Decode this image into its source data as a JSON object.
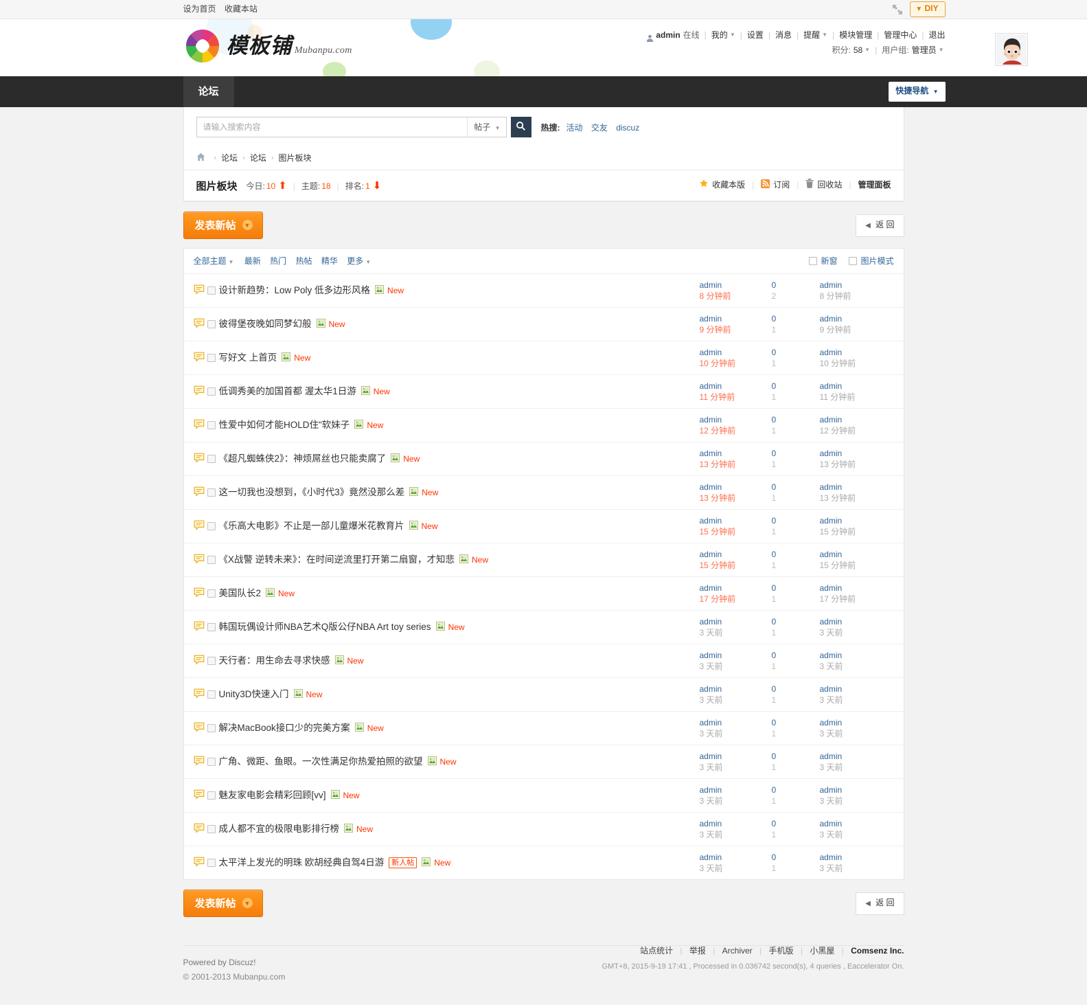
{
  "topbar": {
    "links": [
      "设为首页",
      "收藏本站"
    ],
    "diy_label": "DIY",
    "expand_icon": "expand-icon"
  },
  "logo": {
    "title": "模板铺",
    "subtitle": "Mubanpu.com"
  },
  "user": {
    "name": "admin",
    "status": "在线",
    "menu": [
      "我的",
      "设置",
      "消息",
      "提醒",
      "模块管理",
      "管理中心",
      "退出"
    ],
    "credits_label": "积分:",
    "credits_value": "58",
    "group_label": "用户组:",
    "group_value": "管理员"
  },
  "nav": {
    "items": [
      "论坛"
    ],
    "quicknav": "快捷导航"
  },
  "search": {
    "placeholder": "请输入搜索内容",
    "value": "",
    "type": "帖子",
    "hot_label": "热搜:",
    "hot_links": [
      "活动",
      "交友",
      "discuz"
    ]
  },
  "breadcrumb": {
    "home_icon": "home-icon",
    "items": [
      "论坛",
      "论坛",
      "图片板块"
    ]
  },
  "forum": {
    "title": "图片板块",
    "today_label": "今日:",
    "today_value": "10",
    "threads_label": "主题:",
    "threads_value": "18",
    "rank_label": "排名:",
    "rank_value": "1",
    "actions": [
      "收藏本版",
      "订阅",
      "回收站",
      "管理面板"
    ]
  },
  "actions": {
    "new_thread": "发表新帖",
    "back": "返 回"
  },
  "filter": {
    "all_topics": "全部主题",
    "tabs": [
      "最新",
      "热门",
      "热帖",
      "精华",
      "更多"
    ],
    "newwindow": "新窗",
    "imagemode": "图片模式"
  },
  "threads": [
    {
      "title": "设计新趋势：Low Poly 低多边形风格",
      "badge": "",
      "new": "New",
      "author": "admin",
      "date": "8 分钟前",
      "fresh": true,
      "replies": "0",
      "views": "2",
      "last_author": "admin",
      "last_date": "8 分钟前"
    },
    {
      "title": "彼得堡夜晚如同梦幻般",
      "badge": "",
      "new": "New",
      "author": "admin",
      "date": "9 分钟前",
      "fresh": true,
      "replies": "0",
      "views": "1",
      "last_author": "admin",
      "last_date": "9 分钟前"
    },
    {
      "title": "写好文 上首页",
      "badge": "",
      "new": "New",
      "author": "admin",
      "date": "10 分钟前",
      "fresh": true,
      "replies": "0",
      "views": "1",
      "last_author": "admin",
      "last_date": "10 分钟前"
    },
    {
      "title": "低调秀美的加国首都 渥太华1日游",
      "badge": "",
      "new": "New",
      "author": "admin",
      "date": "11 分钟前",
      "fresh": true,
      "replies": "0",
      "views": "1",
      "last_author": "admin",
      "last_date": "11 分钟前"
    },
    {
      "title": "性爱中如何才能HOLD住\"软妹子",
      "badge": "",
      "new": "New",
      "author": "admin",
      "date": "12 分钟前",
      "fresh": true,
      "replies": "0",
      "views": "1",
      "last_author": "admin",
      "last_date": "12 分钟前"
    },
    {
      "title": "《超凡蜘蛛侠2》：神烦屌丝也只能卖腐了",
      "badge": "",
      "new": "New",
      "author": "admin",
      "date": "13 分钟前",
      "fresh": true,
      "replies": "0",
      "views": "1",
      "last_author": "admin",
      "last_date": "13 分钟前"
    },
    {
      "title": "这一切我也没想到，《小时代3》竟然没那么差",
      "badge": "",
      "new": "New",
      "author": "admin",
      "date": "13 分钟前",
      "fresh": true,
      "replies": "0",
      "views": "1",
      "last_author": "admin",
      "last_date": "13 分钟前"
    },
    {
      "title": "《乐高大电影》不止是一部儿童爆米花教育片",
      "badge": "",
      "new": "New",
      "author": "admin",
      "date": "15 分钟前",
      "fresh": true,
      "replies": "0",
      "views": "1",
      "last_author": "admin",
      "last_date": "15 分钟前"
    },
    {
      "title": "《X战警 逆转未来》：在时间逆流里打开第二扇窗，才知悲",
      "badge": "",
      "new": "New",
      "author": "admin",
      "date": "15 分钟前",
      "fresh": true,
      "replies": "0",
      "views": "1",
      "last_author": "admin",
      "last_date": "15 分钟前"
    },
    {
      "title": "美国队长2",
      "badge": "",
      "new": "New",
      "author": "admin",
      "date": "17 分钟前",
      "fresh": true,
      "replies": "0",
      "views": "1",
      "last_author": "admin",
      "last_date": "17 分钟前"
    },
    {
      "title": "韩国玩偶设计师NBA艺术Q版公仔NBA Art toy series",
      "badge": "",
      "new": "New",
      "author": "admin",
      "date": "3 天前",
      "fresh": false,
      "replies": "0",
      "views": "1",
      "last_author": "admin",
      "last_date": "3 天前"
    },
    {
      "title": "天行者：用生命去寻求快感",
      "badge": "",
      "new": "New",
      "author": "admin",
      "date": "3 天前",
      "fresh": false,
      "replies": "0",
      "views": "1",
      "last_author": "admin",
      "last_date": "3 天前"
    },
    {
      "title": "Unity3D快速入门",
      "badge": "",
      "new": "New",
      "author": "admin",
      "date": "3 天前",
      "fresh": false,
      "replies": "0",
      "views": "1",
      "last_author": "admin",
      "last_date": "3 天前"
    },
    {
      "title": "解决MacBook接口少的完美方案",
      "badge": "",
      "new": "New",
      "author": "admin",
      "date": "3 天前",
      "fresh": false,
      "replies": "0",
      "views": "1",
      "last_author": "admin",
      "last_date": "3 天前"
    },
    {
      "title": "广角、微距、鱼眼。一次性满足你热爱拍照的欲望",
      "badge": "",
      "new": "New",
      "author": "admin",
      "date": "3 天前",
      "fresh": false,
      "replies": "0",
      "views": "1",
      "last_author": "admin",
      "last_date": "3 天前"
    },
    {
      "title": "魅友家电影会精彩回顾[vv]",
      "badge": "",
      "new": "New",
      "author": "admin",
      "date": "3 天前",
      "fresh": false,
      "replies": "0",
      "views": "1",
      "last_author": "admin",
      "last_date": "3 天前"
    },
    {
      "title": "成人都不宜的极限电影排行榜",
      "badge": "",
      "new": "New",
      "author": "admin",
      "date": "3 天前",
      "fresh": false,
      "replies": "0",
      "views": "1",
      "last_author": "admin",
      "last_date": "3 天前"
    },
    {
      "title": "太平洋上发光的明珠 欧胡经典自驾4日游",
      "badge": "新人帖",
      "new": "New",
      "author": "admin",
      "date": "3 天前",
      "fresh": false,
      "replies": "0",
      "views": "1",
      "last_author": "admin",
      "last_date": "3 天前"
    }
  ],
  "footer": {
    "powered": "Powered by Discuz!",
    "copyright": "© 2001-2013 Mubanpu.com",
    "links": [
      "站点统计",
      "举报",
      "Archiver",
      "手机版",
      "小黑屋"
    ],
    "brand": "Comsenz Inc.",
    "meta": "GMT+8, 2015-9-19 17:41 , Processed in 0.036742 second(s), 4 queries , Eaccelerator On."
  },
  "colors": {
    "accent_orange": "#f57c0a",
    "link_blue": "#336699",
    "nav_dark": "#2b2b2b",
    "new_red": "#ff3300"
  }
}
